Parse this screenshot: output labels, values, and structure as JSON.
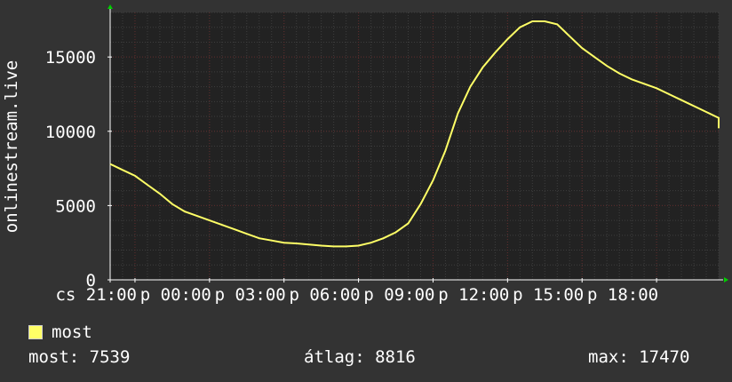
{
  "chart_data": {
    "type": "line",
    "ylabel": "onlinestream.live",
    "ylim": [
      0,
      18000
    ],
    "yticks": [
      0,
      5000,
      10000,
      15000
    ],
    "xtick_labels": [
      "cs 21:00",
      "p 00:00",
      "p 03:00",
      "p 06:00",
      "p 09:00",
      "p 12:00",
      "p 15:00",
      "p 18:00"
    ],
    "x_range_hours": [
      -1,
      23.5
    ],
    "grid": true,
    "colors": {
      "background": "#333333",
      "plot_area": "#222222",
      "grid_minor": "#3e3e3e",
      "grid_major": "#5e2a2a",
      "line": "#ffff66",
      "axis_arrow": "#00cc00",
      "text": "#ffffff"
    },
    "series": [
      {
        "name": "most",
        "color": "#ffff66",
        "x": [
          -1,
          -0.5,
          0,
          0.5,
          1,
          1.5,
          2,
          2.5,
          3,
          3.5,
          4,
          4.5,
          5,
          5.5,
          6,
          6.5,
          7,
          7.5,
          8,
          8.5,
          9,
          9.5,
          10,
          10.5,
          11,
          11.5,
          12,
          12.5,
          13,
          13.5,
          14,
          14.5,
          15,
          15.5,
          16,
          16.5,
          17,
          17.5,
          18,
          18.5,
          19,
          19.5,
          20,
          20.5,
          21,
          21.5,
          22,
          22.5,
          23,
          23.5,
          24
        ],
        "values": [
          7800,
          7400,
          7000,
          6400,
          5800,
          5100,
          4600,
          4300,
          4000,
          3700,
          3400,
          3100,
          2800,
          2650,
          2500,
          2450,
          2380,
          2300,
          2250,
          2250,
          2300,
          2500,
          2800,
          3200,
          3800,
          5100,
          6700,
          8700,
          11200,
          13000,
          14300,
          15300,
          16200,
          17000,
          17400,
          17400,
          17200,
          16400,
          15600,
          15000,
          14400,
          13900,
          13500,
          13200,
          12900,
          12500,
          12100,
          11700,
          11300,
          10900,
          10200
        ]
      }
    ],
    "legend": {
      "label": "most",
      "placement": "bottom-left"
    }
  },
  "stats": {
    "current": "most: 7539",
    "average": "átlag: 8816",
    "maximum": "max: 17470"
  }
}
